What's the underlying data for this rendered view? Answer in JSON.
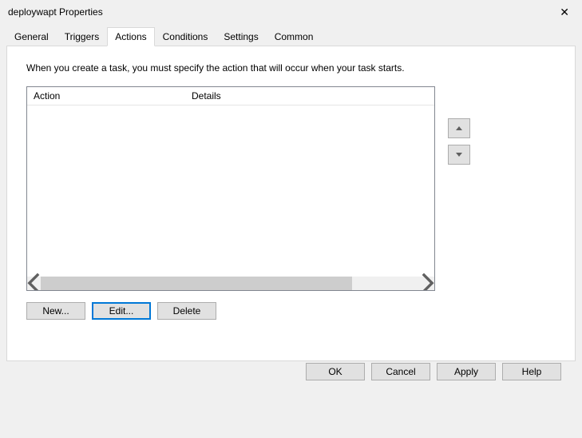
{
  "title": "deploywapt Properties",
  "tabs": [
    "General",
    "Triggers",
    "Actions",
    "Conditions",
    "Settings",
    "Common"
  ],
  "activeTabIndex": 2,
  "instruction": "When you create a task, you must specify the action that will occur when your task starts.",
  "columns": {
    "action": "Action",
    "details": "Details"
  },
  "buttons": {
    "new": "New...",
    "edit": "Edit...",
    "delete": "Delete",
    "ok": "OK",
    "cancel": "Cancel",
    "apply": "Apply",
    "help": "Help"
  }
}
